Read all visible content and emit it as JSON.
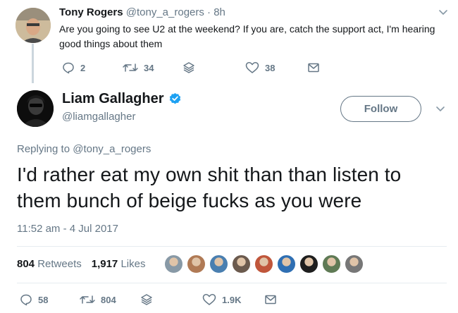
{
  "parent_tweet": {
    "author_name": "Tony Rogers",
    "author_handle": "@tony_a_rogers",
    "separator": " · ",
    "time": "8h",
    "text": "Are you going to see U2 at the weekend? If you are, catch the support act, I'm hearing good things about them",
    "actions": {
      "replies": "2",
      "retweets": "34",
      "likes": "38"
    }
  },
  "main_tweet": {
    "author_name": "Liam Gallagher",
    "author_handle": "@liamgallagher",
    "follow_label": "Follow",
    "replying_prefix": "Replying to ",
    "replying_handle": "@tony_a_rogers",
    "text": "I'd rather eat my own shit than than listen to them bunch of beige fucks as you were",
    "timestamp": "11:52 am - 4 Jul 2017",
    "stats": {
      "retweets_count": "804",
      "retweets_label": "Retweets",
      "likes_count": "1,917",
      "likes_label": "Likes"
    },
    "actions": {
      "replies": "58",
      "retweets": "804",
      "likes": "1.9K"
    }
  },
  "icons": {
    "reply": "reply-icon",
    "retweet": "retweet-icon",
    "stack": "stack-icon",
    "like": "heart-icon",
    "message": "envelope-icon",
    "caret": "chevron-down-icon",
    "verified": "verified-badge-icon"
  },
  "colors": {
    "text_primary": "#14171a",
    "text_secondary": "#657786",
    "verified_blue": "#1da1f2",
    "divider": "#e6ecf0",
    "thread_line": "#ccd6dd"
  },
  "liker_colors": [
    "#8899a6",
    "#b07a55",
    "#4a7fb0",
    "#6b5a4e",
    "#c0563b",
    "#2f6fb3",
    "#1e1e1e",
    "#5f7a55",
    "#777777"
  ]
}
